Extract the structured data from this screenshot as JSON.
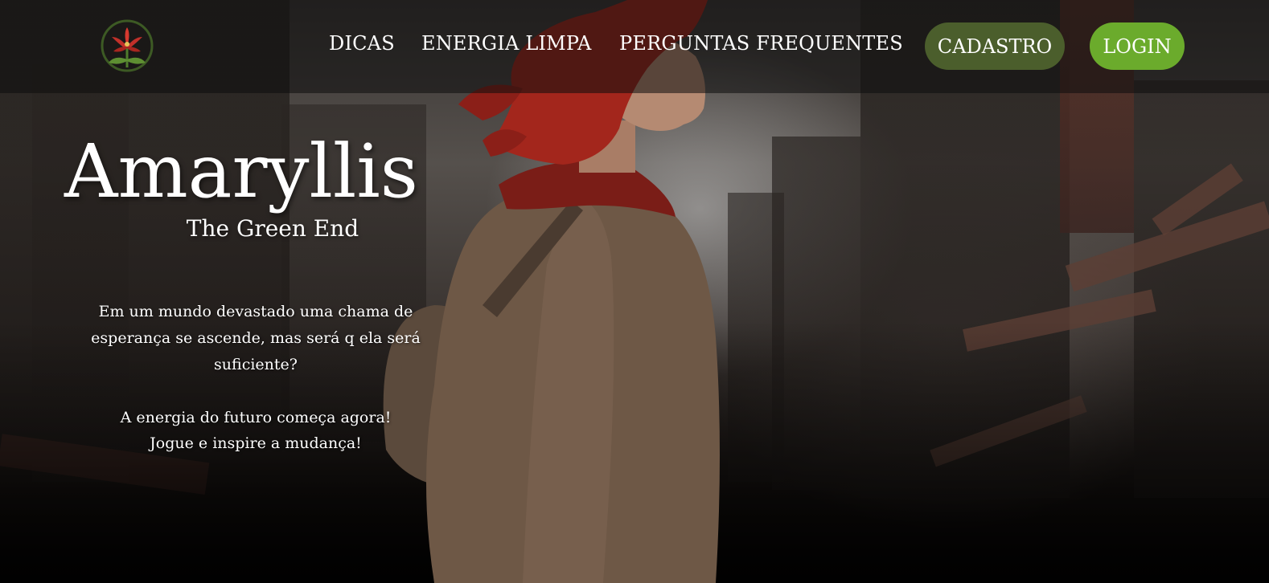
{
  "nav": {
    "logo_icon": "amaryllis-flower-icon",
    "links": [
      {
        "label": "DICAS"
      },
      {
        "label": "ENERGIA LIMPA"
      },
      {
        "label": "PERGUNTAS FREQUENTES"
      }
    ],
    "cadastro_label": "CADASTRO",
    "login_label": "LOGIN"
  },
  "hero": {
    "title": "Amaryllis",
    "subtitle": "The Green End",
    "description": "Em um mundo devastado uma chama de esperança se ascende, mas será q ela será suficiente?",
    "tagline_line1": "A energia do futuro começa agora!",
    "tagline_line2": "Jogue e inspire a mudança!"
  },
  "colors": {
    "cadastro_bg": "#4b5e2c",
    "login_bg": "#6bab2c",
    "nav_bg": "rgba(12,12,12,0.55)",
    "hair": "#a3261c"
  }
}
